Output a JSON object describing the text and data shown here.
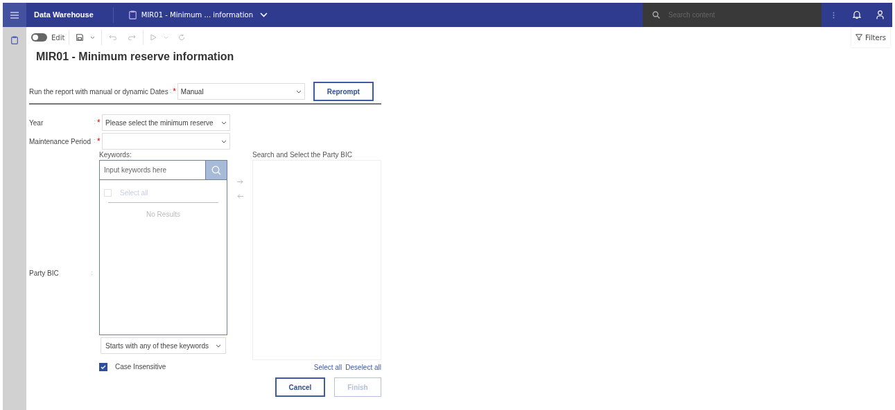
{
  "top_bar": {
    "app_name": "Data Warehouse",
    "tab_title": "MIR01 - Minimum ... information",
    "search_placeholder": "Search content"
  },
  "toolbar": {
    "edit_toggle": {
      "label": "Edit",
      "on": false
    },
    "filters": "Filters"
  },
  "title": "MIR01 - Minimum reserve information",
  "date_prompt": {
    "label": "Run the report with manual or dynamic Dates",
    "colon": ":",
    "required_mark": "*",
    "value": "Manual",
    "button": "Reprompt"
  },
  "fields": [
    {
      "label": "Year",
      "colon": ":",
      "required_mark": "*",
      "value": "Please select the minimum reserve"
    },
    {
      "label": "Maintenance Period",
      "colon": ":",
      "required_mark": "*"
    }
  ],
  "party_bic": {
    "label": "Party BIC",
    "colon": ":",
    "keywords_label": "Keywords:",
    "keywords_placeholder": "Input keywords here",
    "select_all_option": {
      "label": "Select all",
      "checked": false,
      "disabled": true
    },
    "empty_message": "No Results",
    "match_mode": "Starts with any of these keywords",
    "case_insensitive": {
      "label": "Case Insensitive",
      "checked": true
    },
    "selected_label": "Search and Select the Party BIC",
    "select_all": "Select all",
    "deselect_all": "Deselect all"
  },
  "buttons": [
    {
      "label": "Cancel",
      "disabled": false
    },
    {
      "label": "Finish",
      "disabled": true
    }
  ]
}
